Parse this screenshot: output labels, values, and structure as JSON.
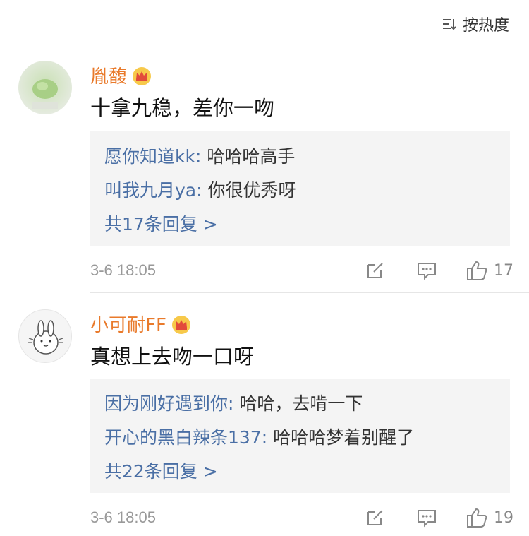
{
  "sort": {
    "label": "按热度"
  },
  "comments": [
    {
      "username": "胤馥",
      "content": "十拿九稳，差你一吻",
      "replies": [
        {
          "user": "愿你知道kk:",
          "text": " 哈哈哈高手"
        },
        {
          "user": "叫我九月ya:",
          "text": " 你很优秀呀"
        }
      ],
      "more_replies": "共17条回复 >",
      "time": "3-6 18:05",
      "likes": "17"
    },
    {
      "username": "小可耐FF",
      "content": "真想上去吻一口呀",
      "replies": [
        {
          "user": "因为刚好遇到你:",
          "text": " 哈哈，去啃一下"
        },
        {
          "user": "开心的黑白辣条137:",
          "text": " 哈哈哈梦着别醒了"
        }
      ],
      "more_replies": "共22条回复 >",
      "time": "3-6 18:05",
      "likes": "19"
    }
  ],
  "colors": {
    "username": "#e97a2b",
    "reply_user": "#4a6fa5",
    "muted": "#999999",
    "reply_bg": "#f4f4f4"
  }
}
